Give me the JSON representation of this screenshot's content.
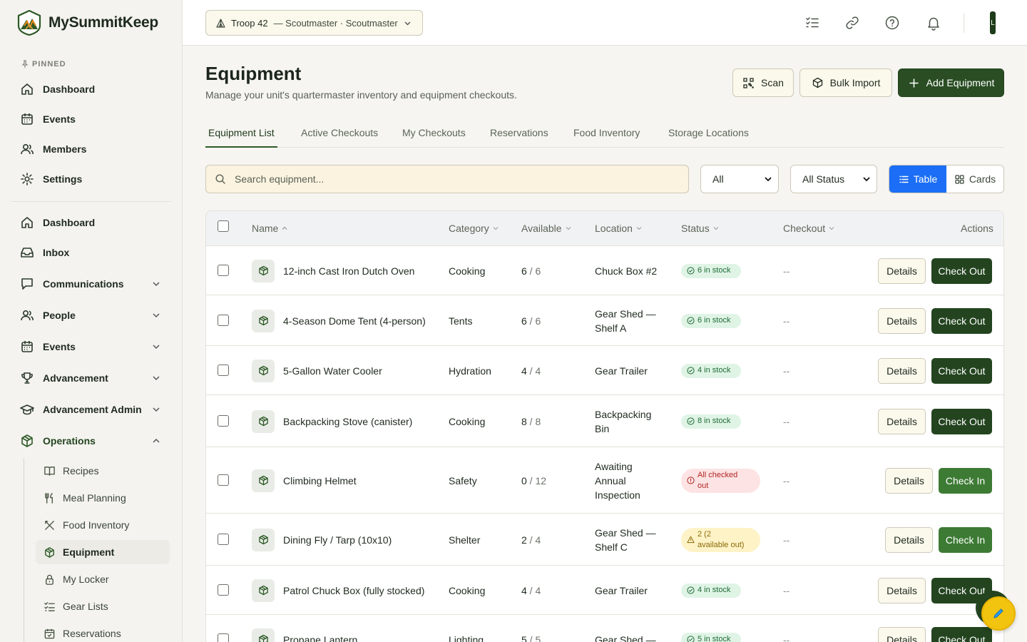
{
  "app": {
    "name": "MySummitKeep"
  },
  "sidebar": {
    "pinned_label": "PINNED",
    "pinned": [
      {
        "label": "Dashboard",
        "icon": "home-icon"
      },
      {
        "label": "Events",
        "icon": "calendar-icon"
      },
      {
        "label": "Members",
        "icon": "users-icon"
      },
      {
        "label": "Settings",
        "icon": "gear-icon"
      }
    ],
    "main": [
      {
        "label": "Dashboard",
        "icon": "home-icon"
      },
      {
        "label": "Inbox",
        "icon": "inbox-icon"
      },
      {
        "label": "Communications",
        "icon": "message-icon",
        "expandable": true
      },
      {
        "label": "People",
        "icon": "users-icon",
        "expandable": true
      },
      {
        "label": "Events",
        "icon": "calendar-icon",
        "expandable": true
      },
      {
        "label": "Advancement",
        "icon": "trophy-icon",
        "expandable": true
      },
      {
        "label": "Advancement Admin",
        "icon": "graduation-cap-icon",
        "expandable": true
      },
      {
        "label": "Operations",
        "icon": "package-icon",
        "expandable": true,
        "expanded": true
      }
    ],
    "operations_sub": [
      {
        "label": "Recipes",
        "icon": "book-icon"
      },
      {
        "label": "Meal Planning",
        "icon": "utensils-icon"
      },
      {
        "label": "Food Inventory",
        "icon": "utensils-crossed-icon"
      },
      {
        "label": "Equipment",
        "icon": "package-icon",
        "active": true
      },
      {
        "label": "My Locker",
        "icon": "lock-icon"
      },
      {
        "label": "Gear Lists",
        "icon": "checklist-icon"
      },
      {
        "label": "Reservations",
        "icon": "calendar-check-icon"
      }
    ]
  },
  "topbar": {
    "unit_name": "Troop 42",
    "unit_role": "— Scoutmaster · Scoutmaster",
    "avatar_initial": "L"
  },
  "page": {
    "title": "Equipment",
    "subtitle": "Manage your unit's quartermaster inventory and equipment checkouts.",
    "buttons": {
      "scan": "Scan",
      "bulk_import": "Bulk Import",
      "add": "Add Equipment"
    },
    "tabs": [
      "Equipment List",
      "Active Checkouts",
      "My Checkouts",
      "Reservations",
      "Food Inventory",
      "Storage Locations"
    ],
    "active_tab": "Equipment List"
  },
  "filters": {
    "search_placeholder": "Search equipment...",
    "category_value": "All",
    "status_value": "All Status",
    "view_table": "Table",
    "view_cards": "Cards",
    "view_selected": "Table"
  },
  "table": {
    "columns": [
      "Name",
      "Category",
      "Available",
      "Location",
      "Status",
      "Checkout",
      "Actions"
    ],
    "details_label": "Details",
    "rows": [
      {
        "name": "12-inch Cast Iron Dutch Oven",
        "category": "Cooking",
        "available": "6",
        "total": "6",
        "location": [
          "Chuck Box #2"
        ],
        "status": [
          "6 in stock"
        ],
        "status_type": "ok",
        "checkout": "--",
        "action": "Check Out"
      },
      {
        "name": "4-Season Dome Tent (4-person)",
        "category": "Tents",
        "available": "6",
        "total": "6",
        "location": [
          "Gear Shed —",
          "Shelf A"
        ],
        "status": [
          "6 in stock"
        ],
        "status_type": "ok",
        "checkout": "--",
        "action": "Check Out"
      },
      {
        "name": "5-Gallon Water Cooler",
        "category": "Hydration",
        "available": "4",
        "total": "4",
        "location": [
          "Gear Trailer"
        ],
        "status": [
          "4 in stock"
        ],
        "status_type": "ok",
        "checkout": "--",
        "action": "Check Out"
      },
      {
        "name": "Backpacking Stove (canister)",
        "category": "Cooking",
        "available": "8",
        "total": "8",
        "location": [
          "Backpacking",
          "Bin"
        ],
        "status": [
          "8 in stock"
        ],
        "status_type": "ok",
        "checkout": "--",
        "action": "Check Out"
      },
      {
        "name": "Climbing Helmet",
        "category": "Safety",
        "available": "0",
        "total": "12",
        "location": [
          "Awaiting",
          "Annual",
          "Inspection"
        ],
        "status": [
          "All checked",
          "out"
        ],
        "status_type": "bad",
        "checkout": "--",
        "action": "Check In"
      },
      {
        "name": "Dining Fly / Tarp (10x10)",
        "category": "Shelter",
        "available": "2",
        "total": "4",
        "location": [
          "Gear Shed —",
          "Shelf C"
        ],
        "status": [
          "2            (2",
          "available out)"
        ],
        "status_type": "warn",
        "checkout": "--",
        "action": "Check In"
      },
      {
        "name": "Patrol Chuck Box (fully stocked)",
        "category": "Cooking",
        "available": "4",
        "total": "4",
        "location": [
          "Gear Trailer"
        ],
        "status": [
          "4 in stock"
        ],
        "status_type": "ok",
        "checkout": "--",
        "action": "Check Out"
      },
      {
        "name": "Propane Lantern",
        "category": "Lighting",
        "available": "5",
        "total": "5",
        "location": [
          "Gear Shed —"
        ],
        "status": [
          "5 in stock"
        ],
        "status_type": "ok",
        "checkout": "--",
        "action": "Check Out"
      }
    ]
  },
  "colors": {
    "brand_green": "#2a4d24",
    "accent_blue": "#1b6ef5",
    "fab_yellow": "#f2c40f"
  }
}
